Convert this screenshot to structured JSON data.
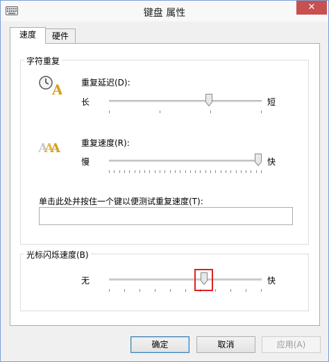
{
  "window": {
    "title": "键盘 属性",
    "close_glyph": "✕"
  },
  "tabs": [
    {
      "label": "速度",
      "active": true
    },
    {
      "label": "硬件",
      "active": false
    }
  ],
  "char_repeat": {
    "group_label": "字符重复",
    "delay": {
      "label": "重复延迟(D):",
      "min_label": "长",
      "max_label": "短",
      "value_fraction": 0.66,
      "tick_count": 4
    },
    "rate": {
      "label": "重复速度(R):",
      "min_label": "慢",
      "max_label": "快",
      "value_fraction": 1.0,
      "tick_count": 31
    },
    "test_label": "单击此处并按住一个键以便测试重复速度(T):",
    "test_value": ""
  },
  "cursor_blink": {
    "group_label": "光标闪烁速度(B)",
    "min_label": "无",
    "max_label": "快",
    "value_fraction": 0.63,
    "tick_count": 11
  },
  "buttons": {
    "ok": "确定",
    "cancel": "取消",
    "apply": "应用(A)"
  },
  "colors": {
    "highlight": "#e02020",
    "close_bg": "#c75050",
    "accent": "#3c7fb1"
  }
}
